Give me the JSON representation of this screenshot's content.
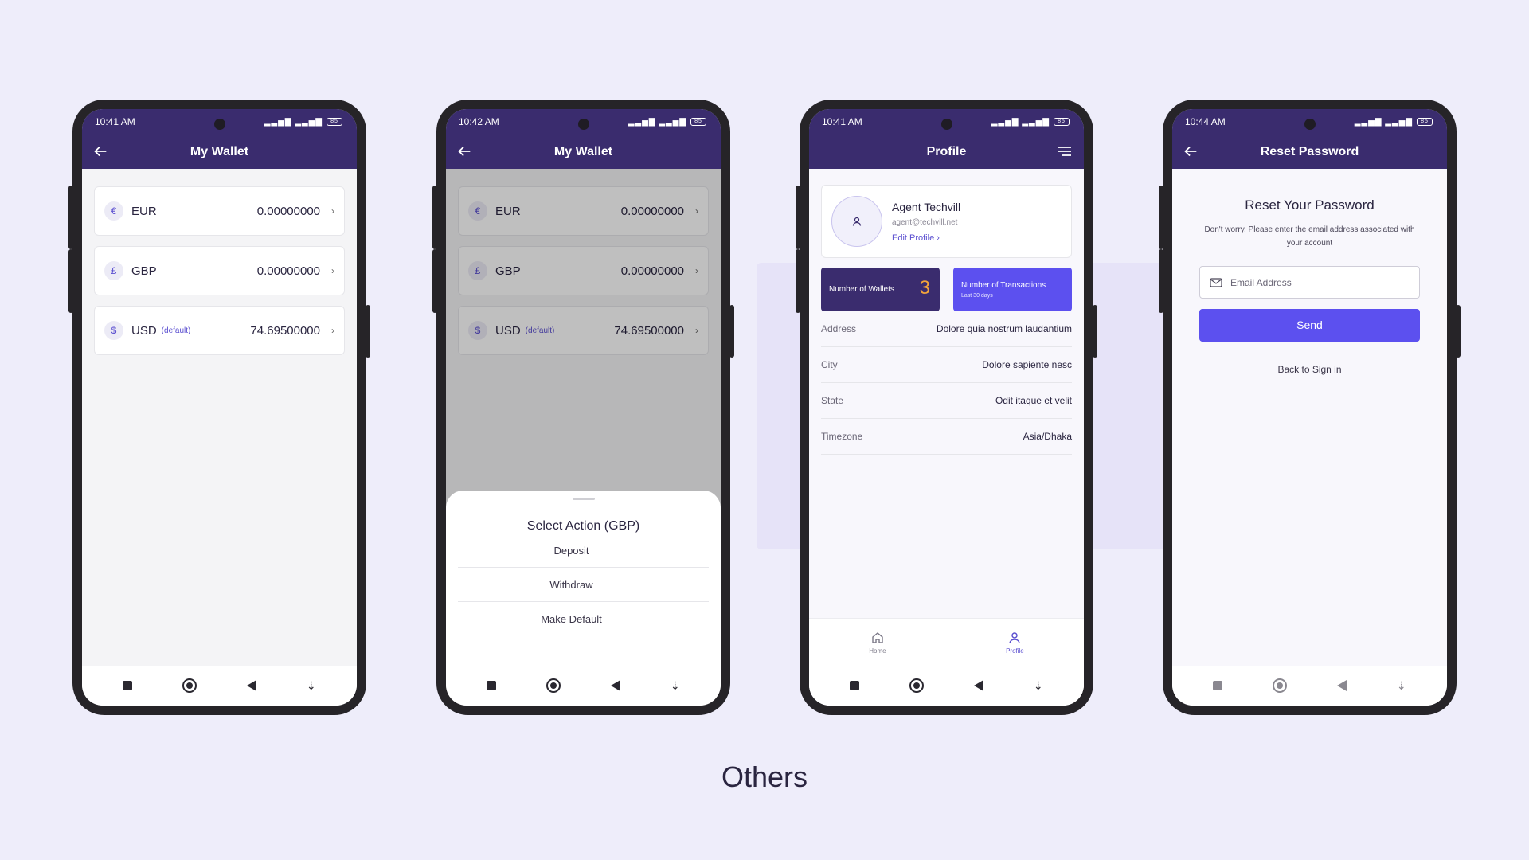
{
  "section_title": "Others",
  "status": {
    "icons": "▂▃▅▇ ▂▃▅▇",
    "battery": "85"
  },
  "screen1": {
    "time": "10:41 AM",
    "title": "My Wallet",
    "wallets": [
      {
        "symbol": "€",
        "code": "EUR",
        "default": "",
        "balance": "0.00000000"
      },
      {
        "symbol": "£",
        "code": "GBP",
        "default": "",
        "balance": "0.00000000"
      },
      {
        "symbol": "$",
        "code": "USD",
        "default": "(default)",
        "balance": "74.69500000"
      }
    ]
  },
  "screen2": {
    "time": "10:42 AM",
    "title": "My Wallet",
    "sheet_title": "Select Action (GBP)",
    "actions": [
      "Deposit",
      "Withdraw",
      "Make Default"
    ]
  },
  "screen3": {
    "time": "10:41 AM",
    "title": "Profile",
    "name": "Agent Techvill",
    "email": "agent@techvill.net",
    "edit_label": "Edit Profile",
    "wallets_label": "Number of Wallets",
    "wallets_count": "3",
    "transactions_label": "Number of Transactions",
    "transactions_sub": "Last 30 days",
    "info": [
      {
        "key": "Address",
        "value": "Dolore quia nostrum laudantium"
      },
      {
        "key": "City",
        "value": "Dolore sapiente nesc"
      },
      {
        "key": "State",
        "value": "Odit itaque et velit"
      },
      {
        "key": "Timezone",
        "value": "Asia/Dhaka"
      }
    ],
    "tabs": [
      "Home",
      "Profile"
    ]
  },
  "screen4": {
    "time": "10:44 AM",
    "title": "Reset Password",
    "heading": "Reset Your Password",
    "description": "Don't worry. Please enter the email address associated with your account",
    "email_placeholder": "Email Address",
    "send_label": "Send",
    "back_label": "Back to Sign in"
  },
  "colors": {
    "background": "#eeedfa",
    "appbar": "#3a2c6e",
    "accent": "#5c50ef",
    "highlight": "#f4a53a"
  }
}
